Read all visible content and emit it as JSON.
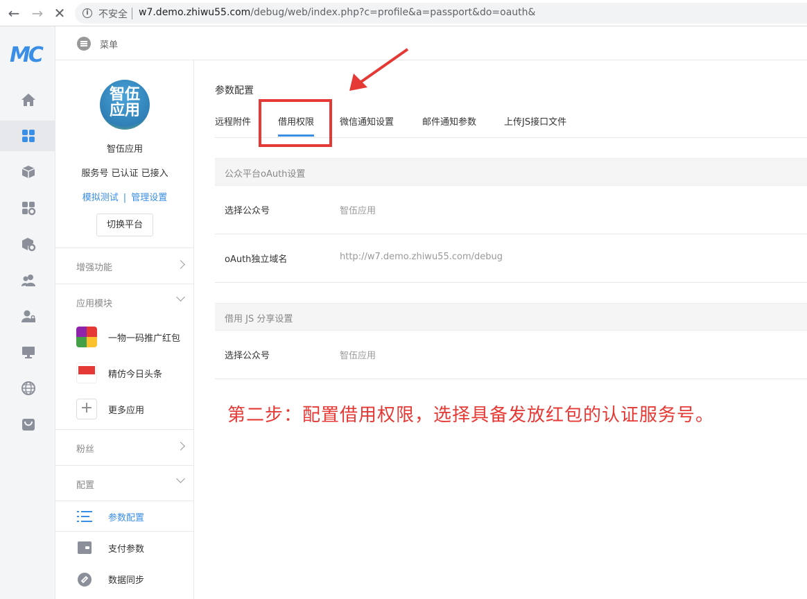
{
  "browser": {
    "security_label": "不安全",
    "url_host": "w7.demo.zhiwu55.com",
    "url_path": "/debug/web/index.php?c=profile&a=passport&do=oauth&"
  },
  "rail": {
    "logo": "MC",
    "items": [
      "home-icon",
      "apps-grid-icon",
      "box-icon",
      "module-settings-icon",
      "package-settings-icon",
      "users-icon",
      "user-lock-icon",
      "monitor-icon",
      "globe-icon",
      "store-icon"
    ]
  },
  "header": {
    "menu_label": "菜单"
  },
  "account": {
    "avatar_text_1": "智伍",
    "avatar_text_2": "应用",
    "name": "智伍应用",
    "status": "服务号 已认证 已接入",
    "link_test": "模拟测试",
    "link_divider": "|",
    "link_manage": "管理设置",
    "switch_button": "切换平台"
  },
  "sidebar": {
    "enhance": "增强功能",
    "modules": "应用模块",
    "module_items": [
      "一物一码推广红包",
      "精仿今日头条",
      "更多应用"
    ],
    "fans": "粉丝",
    "config": "配置",
    "config_items": [
      "参数配置",
      "支付参数",
      "数据同步"
    ]
  },
  "main": {
    "title": "参数配置",
    "tabs": [
      "远程附件",
      "借用权限",
      "微信通知设置",
      "邮件通知参数",
      "上传JS接口文件"
    ],
    "active_tab": "借用权限",
    "oauth_section": {
      "heading": "公众平台oAuth设置",
      "rows": [
        {
          "label": "选择公众号",
          "value": "智伍应用"
        },
        {
          "label": "oAuth独立域名",
          "value": "http://w7.demo.zhiwu55.com/debug"
        }
      ]
    },
    "js_section": {
      "heading": "借用 JS 分享设置",
      "rows": [
        {
          "label": "选择公众号",
          "value": "智伍应用"
        }
      ]
    }
  },
  "annotation": {
    "note": "第二步：配置借用权限，选择具备发放红包的认证服务号。",
    "highlight_color": "#e53935"
  },
  "colors": {
    "accent": "#3a8ee6",
    "annotation": "#e53935"
  }
}
